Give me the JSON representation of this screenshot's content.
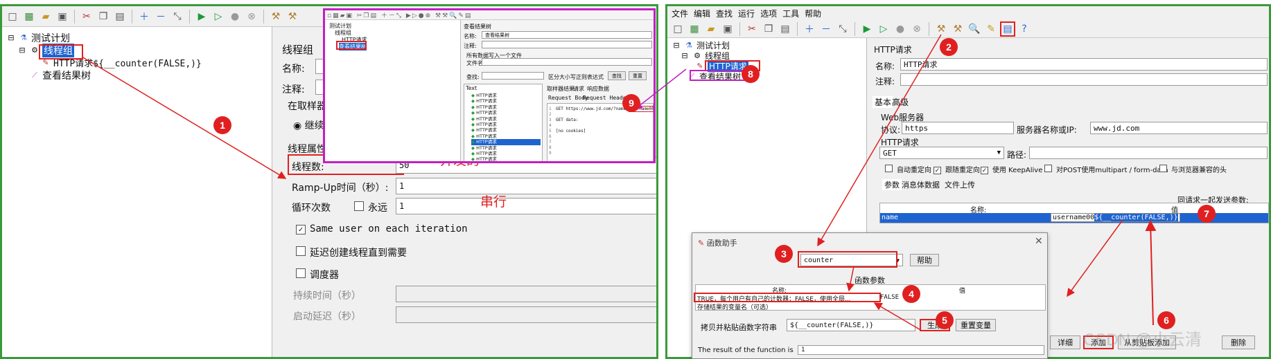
{
  "left": {
    "tree": {
      "plan": "测试计划",
      "thread_group": "线程组",
      "http_request": "HTTP请求${__counter(FALSE,)}",
      "results_tree": "查看结果树"
    },
    "form": {
      "title": "线程组",
      "name_label": "名称:",
      "comment_label": "注释:",
      "sampler_error_label": "在取样器",
      "continue_label": "继续",
      "thread_props_label": "线程属性",
      "threads_label": "线程数:",
      "threads_value": "50",
      "rampup_label": "Ramp-Up时间（秒）:",
      "rampup_value": "1",
      "loop_label": "循环次数",
      "forever_label": "永远",
      "loop_value": "1",
      "same_user_label": "Same user on each iteration",
      "delay_label": "延迟创建线程直到需要",
      "scheduler_label": "调度器",
      "duration_label": "持续时间（秒）",
      "startup_delay_label": "启动延迟（秒）"
    },
    "annotations": {
      "concurrent": "并发的",
      "serial": "串行"
    },
    "inset": {
      "tree_plan": "测试计划",
      "tree_thread_group": "线程组",
      "tree_http": "HTTP请求",
      "tree_results": "查看结果树",
      "title": "查看结果树",
      "name_label": "名称:",
      "name_value": "查看结果树",
      "comment_label": "注释:",
      "write_all_label": "所有数据写入一个文件",
      "filename_label": "文件名",
      "search_label": "查找:",
      "case_label": "区分大小写",
      "regex_label": "正则表达式",
      "search_btn": "查找",
      "reset_btn": "重置",
      "text_header": "Text",
      "tab_sampler": "取样器结果",
      "tab_request": "请求",
      "tab_response": "响应数据",
      "subtab_body": "Request Body",
      "subtab_headers": "Request Headers",
      "results": [
        "HTTP请求",
        "HTTP请求",
        "HTTP请求",
        "HTTP请求",
        "HTTP请求",
        "HTTP请求",
        "HTTP请求",
        "HTTP请求",
        "HTTP请求",
        "HTTP请求",
        "HTTP请求",
        "HTTP请求"
      ],
      "line1": "GET https://www.jd.com/?name=",
      "line1_hl": "username008",
      "line3": "GET data:",
      "line5": "[no cookies]",
      "line_numbers": [
        "1",
        "2",
        "3",
        "4",
        "5",
        "6",
        "7",
        "8",
        "9"
      ]
    }
  },
  "right": {
    "menu": [
      "文件",
      "编辑",
      "查找",
      "运行",
      "选项",
      "工具",
      "帮助"
    ],
    "tree": {
      "plan": "测试计划",
      "thread_group": "线程组",
      "http_request": "HTTP请求",
      "results_tree": "查看结果树"
    },
    "form": {
      "title": "HTTP请求",
      "name_label": "名称:",
      "name_value": "HTTP请求",
      "comment_label": "注释:",
      "tab_basic": "基本",
      "tab_advanced": "高级",
      "web_server": "Web服务器",
      "protocol_label": "协议:",
      "protocol_value": "https",
      "server_label": "服务器名称或IP:",
      "server_value": "www.jd.com",
      "http_req_label": "HTTP请求",
      "method_value": "GET",
      "path_label": "路径:",
      "auto_redirect": "自动重定向",
      "follow_redirect": "跟随重定向",
      "keepalive": "使用 KeepAlive",
      "multipart": "对POST使用multipart / form-data",
      "browser_compat": "与浏览器兼容的头",
      "tab_params": "参数",
      "tab_body": "消息体数据",
      "tab_files": "文件上传",
      "send_with_request": "同请求一起发送参数:",
      "col_name": "名称:",
      "col_value": "值",
      "param_name": "name",
      "param_value_a": "username00",
      "param_value_b": "${__counter(FALSE,)}",
      "btn_detail": "详细",
      "btn_add": "添加",
      "btn_paste": "从剪贴板添加",
      "btn_delete": "删除"
    },
    "dialog": {
      "title": "函数助手",
      "function_value": "counter",
      "help_btn": "帮助",
      "params_label": "函数参数",
      "col_name": "名称:",
      "col_value": "值",
      "row1_name": "TRUE，每个用户有自己的计数器；FALSE，使用全局...",
      "row1_value": "FALSE",
      "row2_name": "存储结果的变量名（可选）",
      "copy_label": "拷贝并粘贴函数字符串",
      "copy_value": "${__counter(FALSE,)}",
      "generate_btn": "生成",
      "reset_btn": "重置变量",
      "result_label": "The result of the function is",
      "result_value": "1"
    },
    "watermark": "CSDN @小云清"
  },
  "badges": [
    "1",
    "2",
    "3",
    "4",
    "5",
    "6",
    "7",
    "8",
    "9"
  ],
  "colors": {
    "annotation_red": "#e02020",
    "panel_border": "#3a9a3a",
    "inset_border": "#c020c0",
    "selection": "#1e64d0"
  }
}
